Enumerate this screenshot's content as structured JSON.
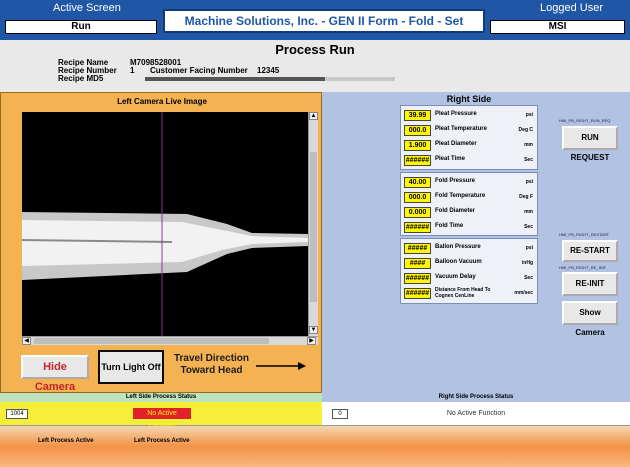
{
  "topbar": {
    "active_screen_label": "Active Screen",
    "active_screen_value": "Run",
    "title": "Machine Solutions, Inc. - GEN II  Form - Fold - Set System",
    "logged_user_label": "Logged User",
    "logged_user_value": "MSI"
  },
  "header": {
    "title": "Process Run",
    "recipe_name_label": "Recipe Name",
    "recipe_name_value": "M7098528001",
    "recipe_number_label": "Recipe Number",
    "recipe_number_value": "1",
    "customer_facing_label": "Customer Facing Number",
    "customer_facing_value": "12345",
    "recipe_md5_label": "Recipe MD5"
  },
  "left": {
    "title": "Left Camera Live Image",
    "hide_camera": "Hide Camera",
    "turn_light_off": "Turn Light Off",
    "travel_line1": "Travel Direction",
    "travel_line2": "Toward Head"
  },
  "right": {
    "title": "Right Side",
    "pleat": [
      {
        "value": "39.99",
        "name": "Pleat Pressure",
        "unit": "psi"
      },
      {
        "value": "000.0",
        "name": "Pleat Temperature",
        "unit": "Deg C"
      },
      {
        "value": "1.900",
        "name": "Pleat Diameter",
        "unit": "mm"
      },
      {
        "value": "######",
        "name": "Pleat Time",
        "unit": "Sec"
      }
    ],
    "fold": [
      {
        "value": "40.00",
        "name": "Fold Pressure",
        "unit": "psi"
      },
      {
        "value": "000.0",
        "name": "Fold Temperature",
        "unit": "Deg F"
      },
      {
        "value": "0.000",
        "name": "Fold Diameter",
        "unit": "mm"
      },
      {
        "value": "######",
        "name": "Fold Time",
        "unit": "Sec"
      }
    ],
    "balloon": [
      {
        "value": "#####",
        "name": "Ballon Pressure",
        "unit": "psi"
      },
      {
        "value": "####",
        "name": "Balloon Vacuum",
        "unit": "inHg"
      },
      {
        "value": "######",
        "name": "Vacuum Delay",
        "unit": "Sec"
      },
      {
        "value": "######",
        "name": "Distance From Head To Cognex CenLine",
        "unit": "mm/sec"
      }
    ],
    "run_request_tag": "HMI_PB_RIGHT_RUN_REQ",
    "run_request": "RUN REQUEST",
    "restart_tag": "HMI_PB_RIGHT_RESTART",
    "restart": "RE-START",
    "reinit_tag": "HMI_PB_RIGHT_RE_INIT",
    "reinit": "RE-INIT",
    "show_camera": "Show Camera"
  },
  "status": {
    "left_title": "Left Side Process Status",
    "right_title": "Right Side Process Status",
    "left_code": "1004",
    "left_message": "No Active Function",
    "right_code": "0",
    "right_message": "No Active Function"
  },
  "footer": {
    "item1": "Left Process Active",
    "item2": "Left Process Active"
  },
  "progress": 0.72,
  "colors": {
    "topbar": "#1f57a6",
    "left_panel": "#f4b252",
    "right_panel": "#b2c2e3",
    "value_box": "#fff700",
    "alert_text": "#e2212a"
  }
}
